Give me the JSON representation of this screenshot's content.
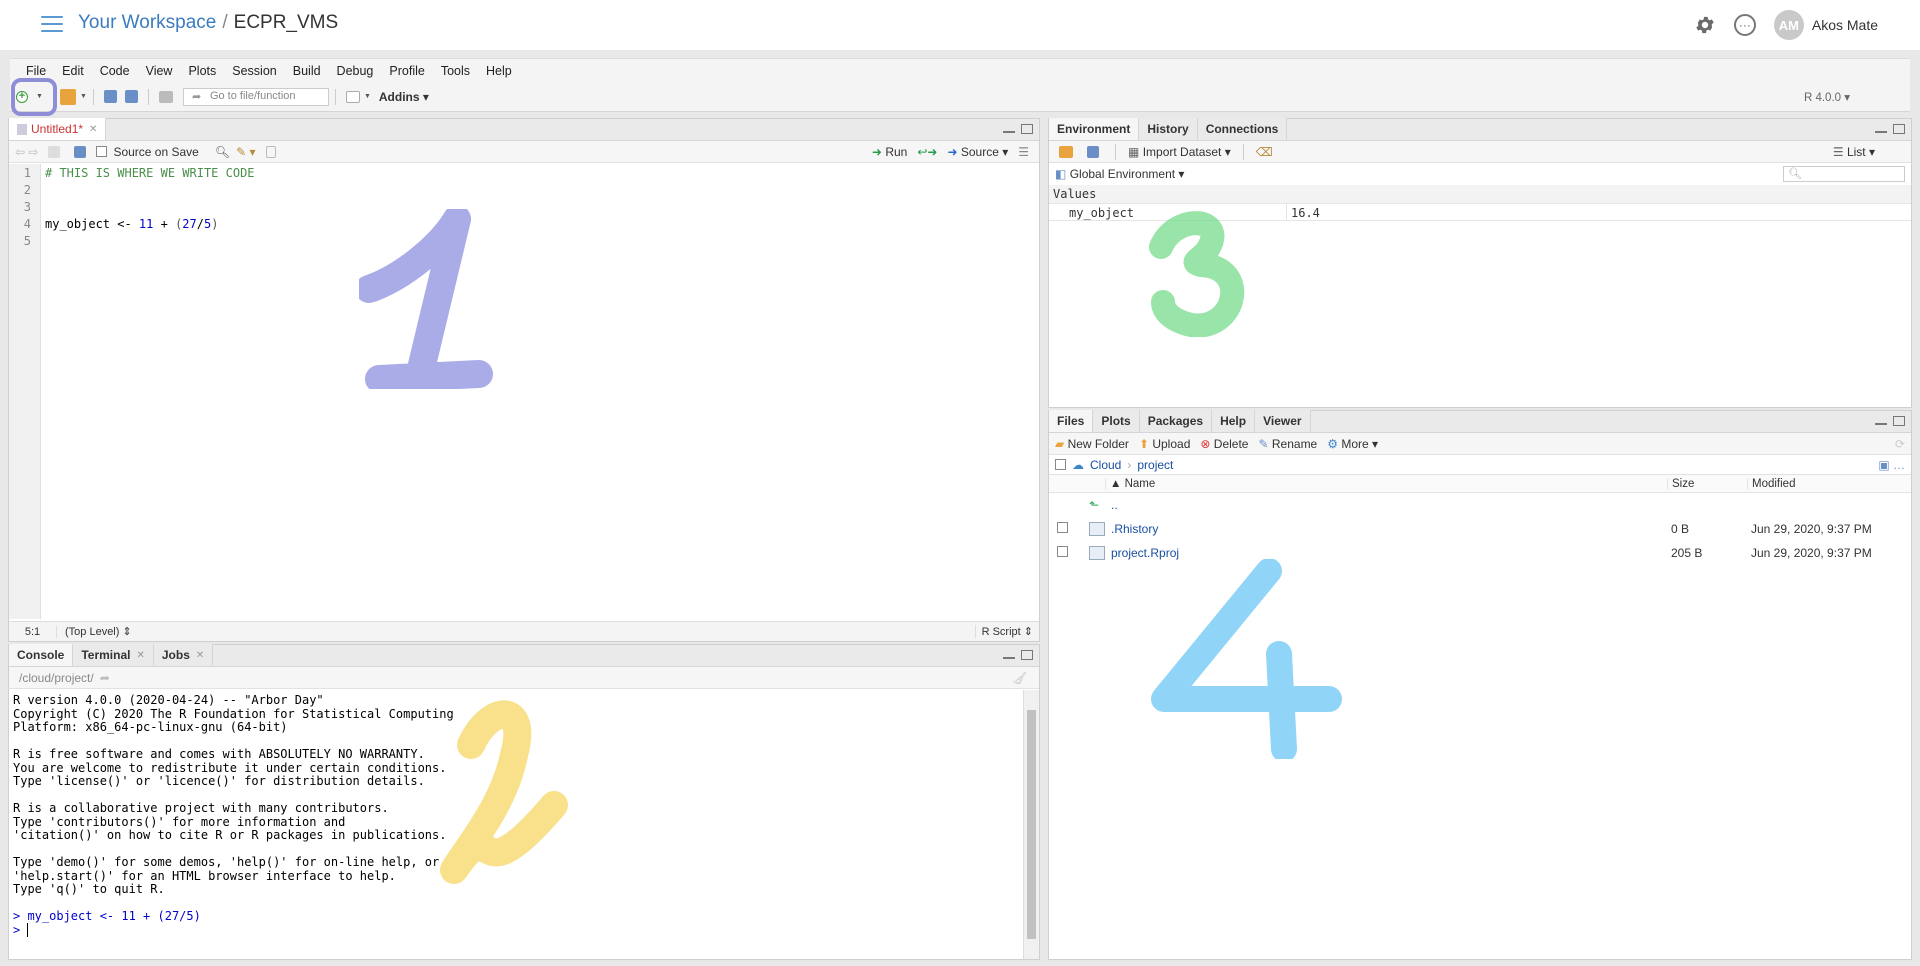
{
  "workspace": {
    "link": "Your Workspace",
    "separator": "/",
    "project": "ECPR_VMS",
    "user_initials": "AM",
    "user_name": "Akos Mate"
  },
  "menu": [
    "File",
    "Edit",
    "Code",
    "View",
    "Plots",
    "Session",
    "Build",
    "Debug",
    "Profile",
    "Tools",
    "Help"
  ],
  "toolbar": {
    "goto_placeholder": "Go to file/function",
    "addins": "Addins",
    "r_version": "R 4.0.0"
  },
  "editor": {
    "tab": "Untitled1*",
    "source_on_save": "Source on Save",
    "run": "Run",
    "source": "Source",
    "lines": [
      {
        "n": "1",
        "text": "# THIS IS WHERE WE WRITE CODE",
        "kind": "comment"
      },
      {
        "n": "2",
        "text": "",
        "kind": "plain"
      },
      {
        "n": "3",
        "text": "",
        "kind": "plain"
      },
      {
        "n": "4",
        "text": "my_object <- 11 + (27/5)",
        "kind": "code"
      },
      {
        "n": "5",
        "text": "",
        "kind": "plain"
      }
    ],
    "status_pos": "5:1",
    "status_scope": "(Top Level)",
    "status_type": "R Script",
    "annotation": "1",
    "annotation_color": "#7b7fd8"
  },
  "console": {
    "tabs": [
      "Console",
      "Terminal",
      "Jobs"
    ],
    "path": "/cloud/project/",
    "lines": [
      "R version 4.0.0 (2020-04-24) -- \"Arbor Day\"",
      "Copyright (C) 2020 The R Foundation for Statistical Computing",
      "Platform: x86_64-pc-linux-gnu (64-bit)",
      "",
      "R is free software and comes with ABSOLUTELY NO WARRANTY.",
      "You are welcome to redistribute it under certain conditions.",
      "Type 'license()' or 'licence()' for distribution details.",
      "",
      "R is a collaborative project with many contributors.",
      "Type 'contributors()' for more information and",
      "'citation()' on how to cite R or R packages in publications.",
      "",
      "Type 'demo()' for some demos, 'help()' for on-line help, or",
      "'help.start()' for an HTML browser interface to help.",
      "Type 'q()' to quit R.",
      ""
    ],
    "input_line": "> my_object <- 11 + (27/5)",
    "prompt": ">",
    "annotation": "2",
    "annotation_color": "#f7d35a"
  },
  "environment": {
    "tabs": [
      "Environment",
      "History",
      "Connections"
    ],
    "import": "Import Dataset",
    "list": "List",
    "scope": "Global Environment",
    "section": "Values",
    "rows": [
      {
        "name": "my_object",
        "value": "16.4"
      }
    ],
    "annotation": "3",
    "annotation_color": "#62d67a"
  },
  "files": {
    "tabs": [
      "Files",
      "Plots",
      "Packages",
      "Help",
      "Viewer"
    ],
    "new_folder": "New Folder",
    "upload": "Upload",
    "delete": "Delete",
    "rename": "Rename",
    "more": "More",
    "path_root": "Cloud",
    "path_sub": "project",
    "col_name": "Name",
    "col_size": "Size",
    "col_modified": "Modified",
    "up": "..",
    "rows": [
      {
        "name": ".Rhistory",
        "size": "0 B",
        "modified": "Jun 29, 2020, 9:37 PM"
      },
      {
        "name": "project.Rproj",
        "size": "205 B",
        "modified": "Jun 29, 2020, 9:37 PM"
      }
    ],
    "annotation": "4",
    "annotation_color": "#54bff2"
  }
}
